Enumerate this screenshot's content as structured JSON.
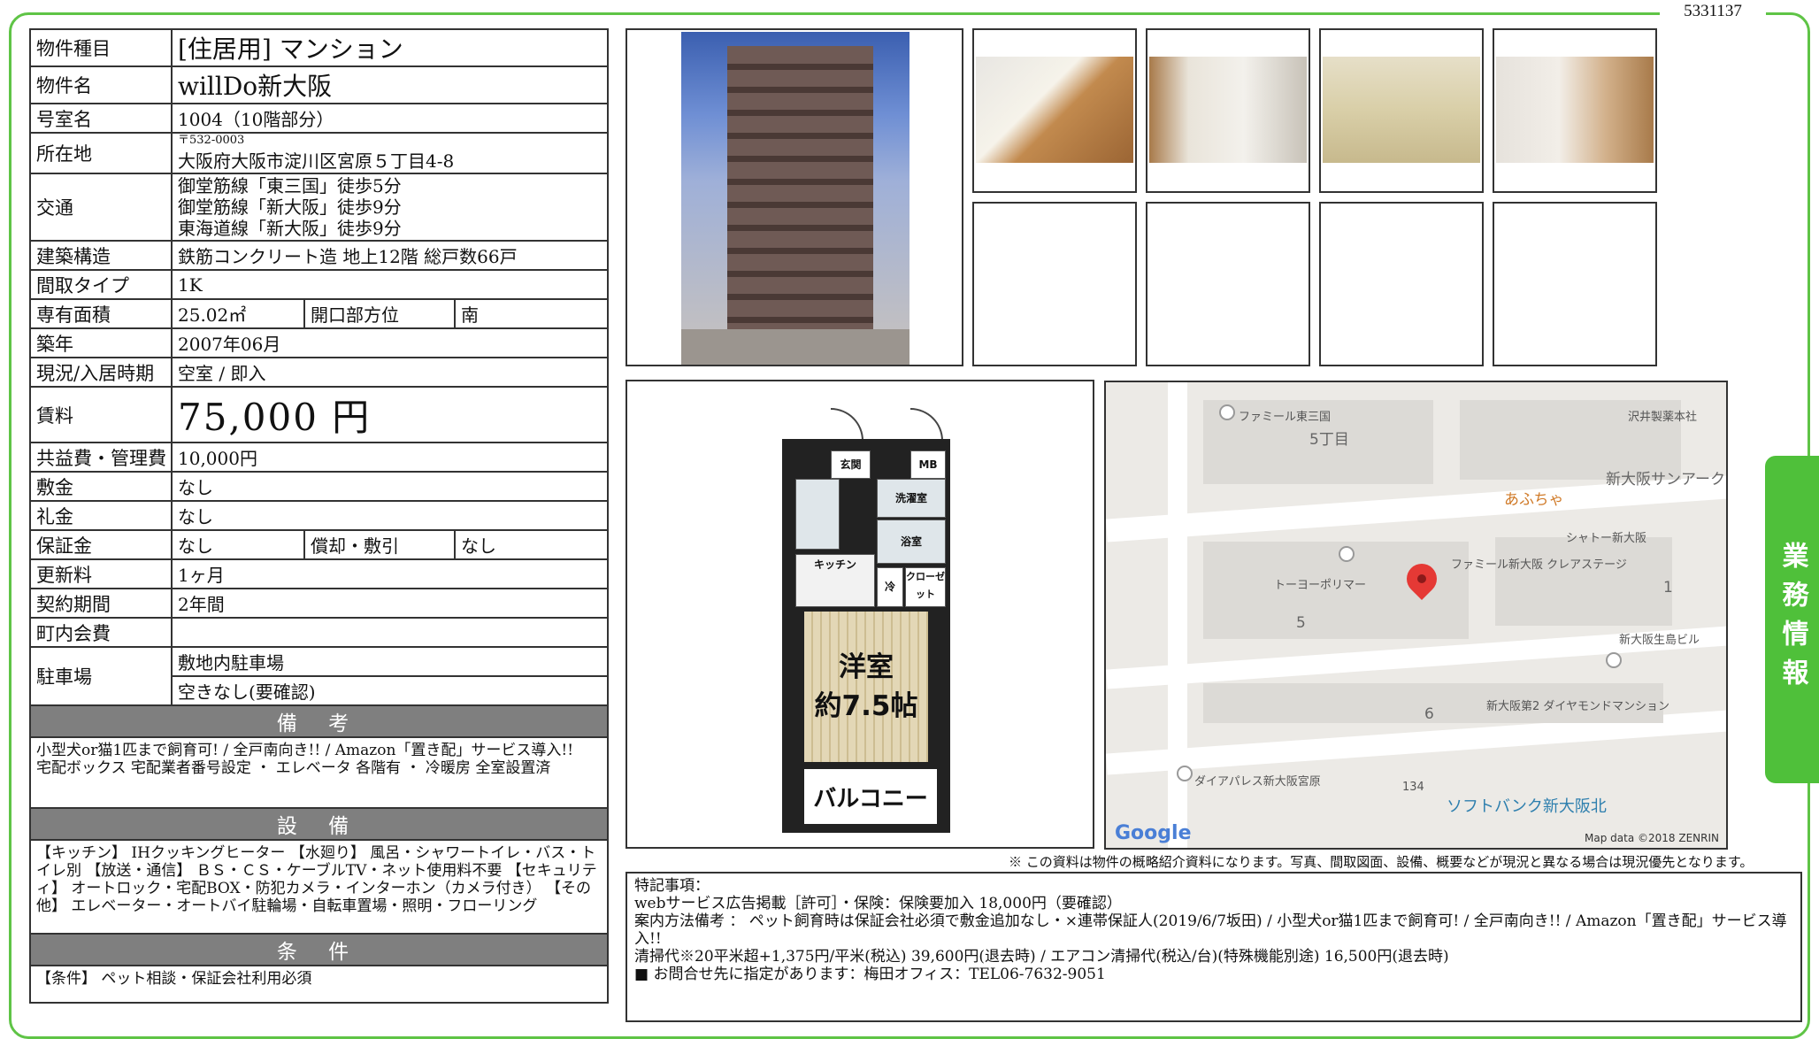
{
  "doc_number": "5331137",
  "side_tab": "業務情報",
  "property": {
    "type_label": "物件種目",
    "type_value": "[住居用] マンション",
    "name_label": "物件名",
    "name_value": "willDo新大阪",
    "room_label": "号室名",
    "room_value": "1004（10階部分）",
    "address_label": "所在地",
    "postal": "〒532-0003",
    "address": "大阪府大阪市淀川区宮原５丁目4-8",
    "access_label": "交通",
    "access": [
      "御堂筋線「東三国」徒歩5分",
      "御堂筋線「新大阪」徒歩9分",
      "東海道線「新大阪」徒歩9分"
    ],
    "structure_label": "建築構造",
    "structure_value": "鉄筋コンクリート造 地上12階 総戸数66戸",
    "layout_label": "間取タイプ",
    "layout_value": "1K",
    "area_label": "専有面積",
    "area_value": "25.02㎡",
    "opening_label": "開口部方位",
    "opening_value": "南",
    "built_label": "築年",
    "built_value": "2007年06月",
    "status_label": "現況/入居時期",
    "status_value": "空室 / 即入",
    "rent_label": "賃料",
    "rent_value": "75,000 円",
    "fee_label": "共益費・管理費",
    "fee_value": "10,000円",
    "deposit_label": "敷金",
    "deposit_value": "なし",
    "key_money_label": "礼金",
    "key_money_value": "なし",
    "guarantee_label": "保証金",
    "guarantee_value": "なし",
    "amort_label": "償却・敷引",
    "amort_value": "なし",
    "renewal_label": "更新料",
    "renewal_value": "1ヶ月",
    "contract_label": "契約期間",
    "contract_value": "2年間",
    "community_label": "町内会費",
    "community_value": "",
    "parking_label": "駐車場",
    "parking_value": "敷地内駐車場",
    "parking_avail": "空きなし(要確認)"
  },
  "sections": {
    "remarks_title": "備 考",
    "remarks_lines": [
      "小型犬or猫1匹まで飼育可!  /  全戸南向き!!  /  Amazon「置き配」サービス導入!!",
      "宅配ボックス 宅配業者番号設定 ・ エレベータ 各階有 ・ 冷暖房 全室設置済"
    ],
    "equipment_title": "設 備",
    "equipment_text": "【キッチン】 IHクッキングヒーター 【水廻り】 風呂・シャワートイレ・バス・トイレ別 【放送・通信】 ＢＳ・ＣＳ・ケーブルTV・ネット使用料不要 【セキュリティ】 オートロック・宅配BOX・防犯カメラ・インターホン（カメラ付き） 【その他】 エレベーター・オートバイ駐輪場・自転車置場・照明・フローリング",
    "conditions_title": "条 件",
    "conditions_text": "【条件】 ペット相談・保証会社利用必須"
  },
  "floor_plan": {
    "room_label": "洋室",
    "room_size": "約7.5帖",
    "balcony": "バルコニー",
    "entrance": "玄関",
    "mb": "MB",
    "washroom": "洗濯室",
    "bath": "浴室",
    "kitchen": "キッチン",
    "closet": "クローゼット",
    "fridge": "冷"
  },
  "map": {
    "labels": [
      "ファミール東三国",
      "5丁目",
      "沢井製薬本社",
      "新大阪サンアーク センタービル",
      "あふちゃ",
      "シャトー新大阪",
      "ファミール新大阪 クレアステージ",
      "トーヨーポリマー",
      "5",
      "1",
      "新大阪生島ビル",
      "新大阪第2 ダイヤモンドマンション",
      "6",
      "ダイアパレス新大阪宮原",
      "134",
      "ソフトバンク新大阪北"
    ],
    "google": "Google",
    "attribution": "Map data ©2018 ZENRIN"
  },
  "disclaimer": "※ この資料は物件の概略紹介資料になります。写真、間取図面、設備、概要などが現況と異なる場合は現況優先となります。",
  "special_notes": {
    "title": "特記事項：",
    "lines": [
      "webサービス広告掲載［許可］・保険：保険要加入 18,000円（要確認）",
      "案内方法備考 ： ペット飼育時は保証会社必須で敷金追加なし・×連帯保証人(2019/6/7坂田)  /  小型犬or猫1匹まで飼育可!  /  全戸南向き!!  /  Amazon「置き配」サービス導入!!",
      "清掃代※20平米超+1,375円/平米(税込) 39,600円(退去時)  /  エアコン清掃代(税込/台)(特殊機能別途) 16,500円(退去時)",
      "■ お問合せ先に指定があります：梅田オフィス：TEL06-7632-9051"
    ]
  },
  "colors": {
    "frame": "#5fc446",
    "side_tab": "#4fc03a",
    "section_header": "#7f7f7f",
    "map_pin": "#e53935"
  }
}
